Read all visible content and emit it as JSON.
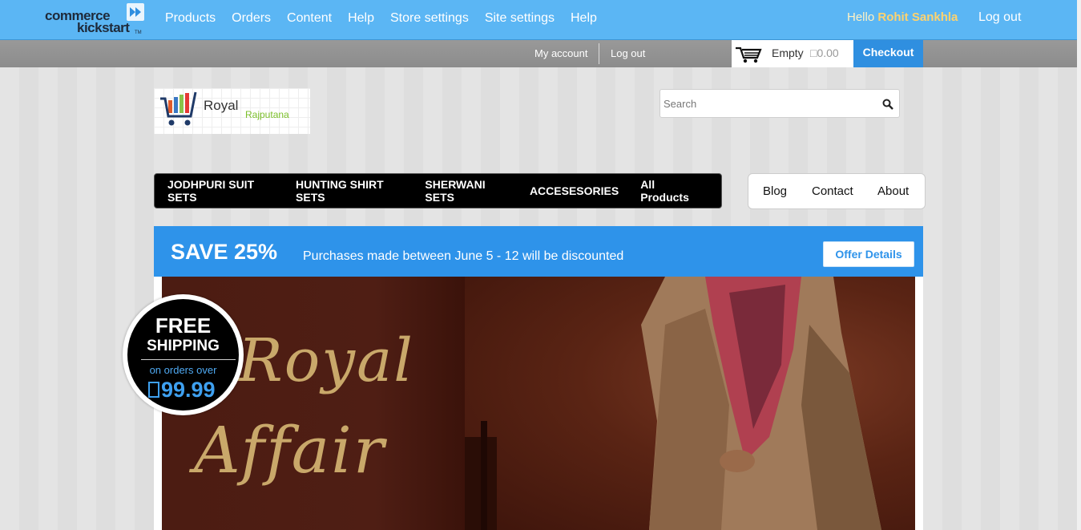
{
  "admin_bar": {
    "logo_word1": "commerce",
    "logo_word2": "kickstart",
    "logo_tm": "TM",
    "nav": [
      "Products",
      "Orders",
      "Content",
      "Help",
      "Store settings",
      "Site settings",
      "Help"
    ],
    "greeting": "Hello",
    "user_name": "Rohit Sankhla",
    "logout": "Log out"
  },
  "sub_bar": {
    "my_account": "My account",
    "logout": "Log out",
    "cart_status": "Empty",
    "cart_amount": "□0.00",
    "checkout": "Checkout"
  },
  "store": {
    "logo_text1": "Royal",
    "logo_text2": "Rajputana"
  },
  "search": {
    "placeholder": "Search"
  },
  "category_nav": [
    "JODHPURI SUIT SETS",
    "HUNTING SHIRT SETS",
    "SHERWANI SETS",
    "ACCESESORIES",
    "All Products"
  ],
  "page_nav": [
    "Blog",
    "Contact",
    "About"
  ],
  "promo": {
    "headline": "SAVE 25%",
    "message": "Purchases made between June 5 - 12 will be discounted",
    "button": "Offer Details"
  },
  "hero": {
    "title_line1": "Royal",
    "title_line2": "Affair"
  },
  "badge": {
    "free": "FREE",
    "shipping": "SHIPPING",
    "subtitle": "on orders over",
    "price": "99.99"
  },
  "colors": {
    "admin_bar": "#5bb6f4",
    "accent_blue": "#2e93ea",
    "user_name": "#ffd36e"
  }
}
